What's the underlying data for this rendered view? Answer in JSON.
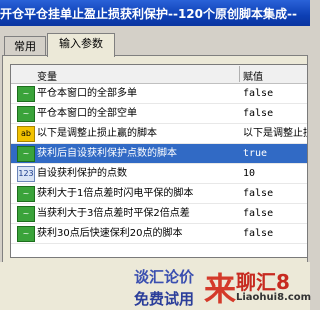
{
  "window": {
    "title": "开仓平仓挂单止盈止损获利保护--120个原创脚本集成--"
  },
  "tabs": [
    {
      "label": "常用"
    },
    {
      "label": "输入参数"
    }
  ],
  "table": {
    "headers": {
      "variable": "变量",
      "value": "赋值"
    },
    "rows": [
      {
        "icon": "toggle-icon",
        "name": "平仓本窗口的全部多单",
        "value": "false"
      },
      {
        "icon": "toggle-icon",
        "name": "平仓本窗口的全部空单",
        "value": "false"
      },
      {
        "icon": "ab-text-icon",
        "name": "以下是调整止损止赢的脚本",
        "value": "以下是调整止损"
      },
      {
        "icon": "toggle-icon",
        "name": "获利后自设获利保护点数的脚本",
        "value": "true",
        "selected": true
      },
      {
        "icon": "number-icon",
        "name": "自设获利保护的点数",
        "value": "10"
      },
      {
        "icon": "toggle-icon",
        "name": "获利大于1倍点差时闪电平保的脚本",
        "value": "false"
      },
      {
        "icon": "toggle-icon",
        "name": "当获利大于3倍点差时平保2倍点差",
        "value": "false"
      },
      {
        "icon": "toggle-icon",
        "name": "获利30点后快速保利20点的脚本",
        "value": "false"
      }
    ]
  },
  "footer": {
    "ad_line1": "谈汇论价",
    "ad_line2": "免费试用",
    "logo_char": "来",
    "logo_name": "聊汇8",
    "logo_url": "Liaohui8.com"
  }
}
